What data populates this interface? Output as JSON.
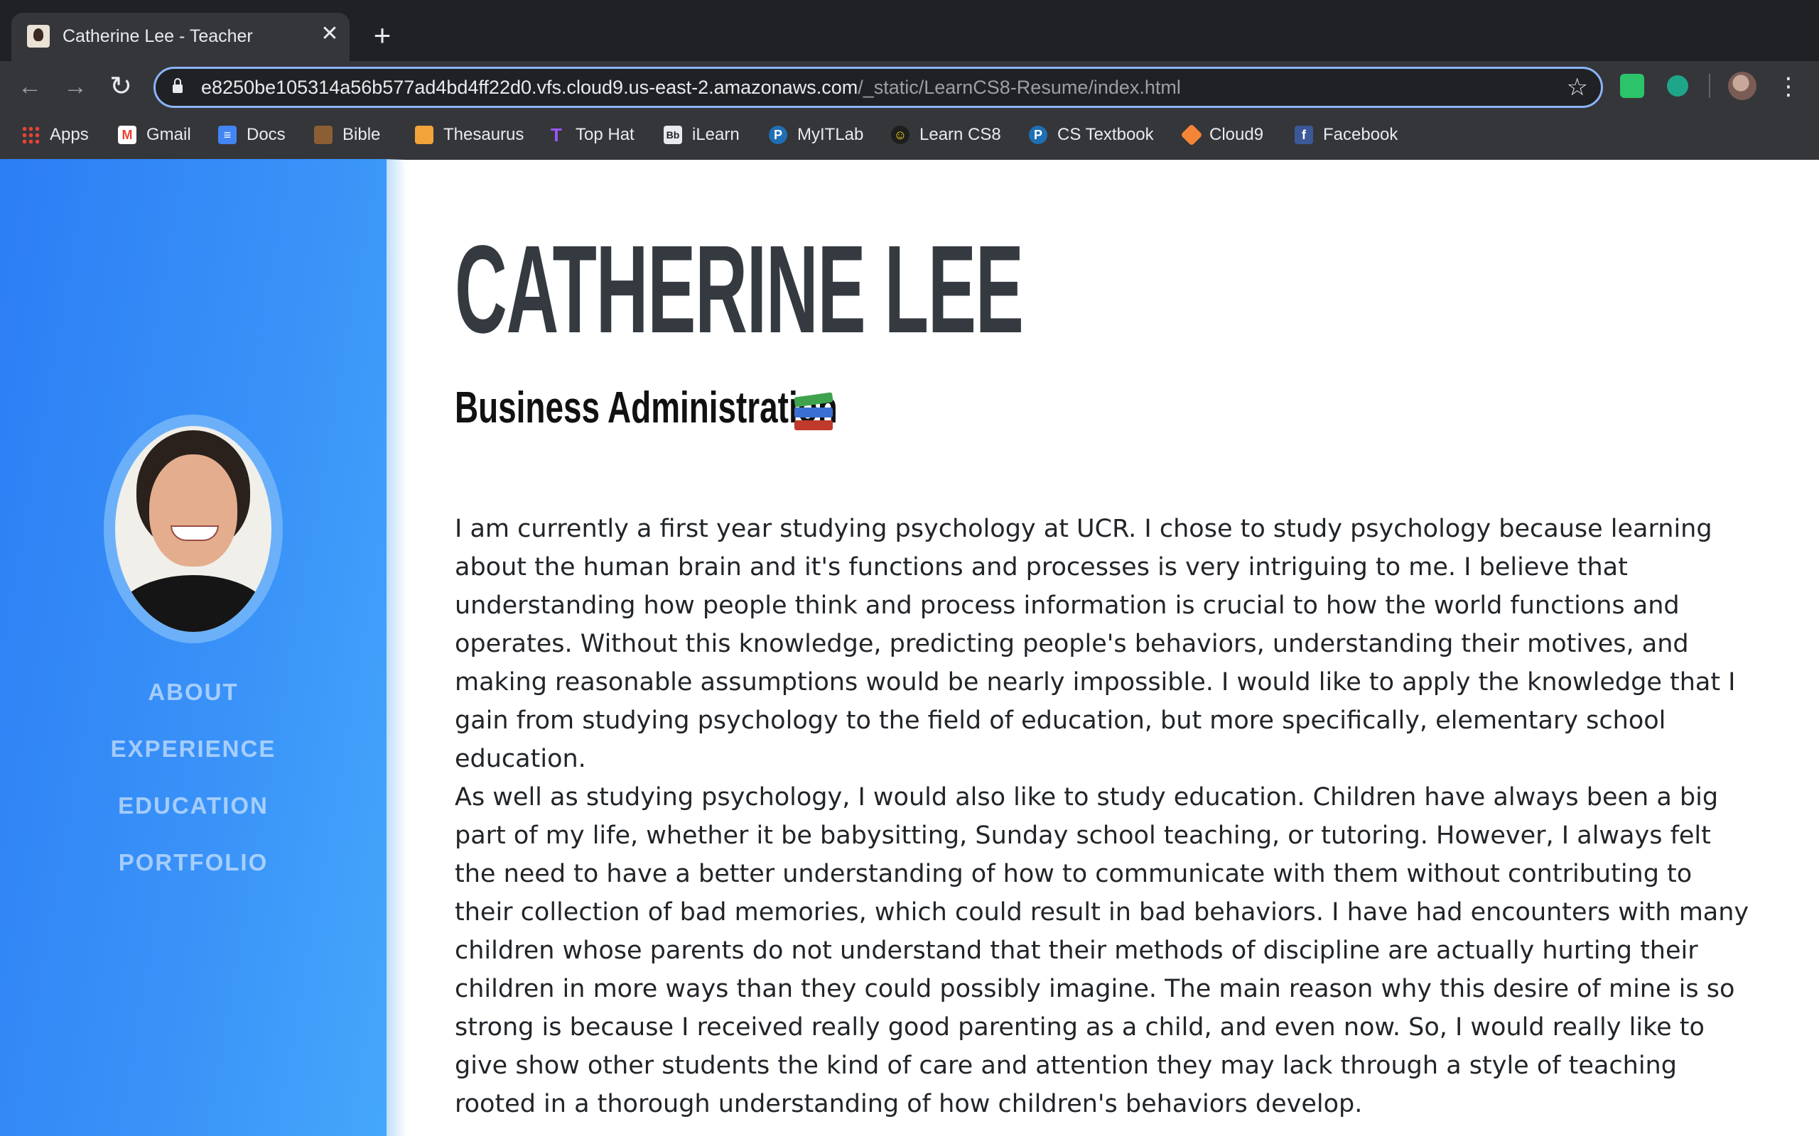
{
  "browser": {
    "tab_title": "Catherine Lee - Teacher",
    "url_host": "e8250be105314a56b577ad4bd4ff22d0.vfs.cloud9.us-east-2.amazonaws.com",
    "url_path": "/_static/LearnCS8-Resume/index.html",
    "bookmarks": [
      {
        "label": "Apps",
        "icon": "apps-grid-icon"
      },
      {
        "label": "Gmail",
        "icon": "gmail-icon"
      },
      {
        "label": "Docs",
        "icon": "docs-icon"
      },
      {
        "label": "Bible",
        "icon": "bible-icon"
      },
      {
        "label": "Thesaurus",
        "icon": "thesaurus-icon"
      },
      {
        "label": "Top Hat",
        "icon": "tophat-icon"
      },
      {
        "label": "iLearn",
        "icon": "blackboard-icon"
      },
      {
        "label": "MyITLab",
        "icon": "pearson-icon"
      },
      {
        "label": "Learn CS8",
        "icon": "learncs8-icon"
      },
      {
        "label": "CS Textbook",
        "icon": "pearson-icon"
      },
      {
        "label": "Cloud9",
        "icon": "cloud9-icon"
      },
      {
        "label": "Facebook",
        "icon": "facebook-icon"
      }
    ],
    "icons": {
      "back": "←",
      "forward": "→",
      "reload": "↻",
      "star": "☆",
      "close": "✕",
      "new_tab": "+",
      "menu": "⋮"
    }
  },
  "colors": {
    "sidebar_start": "#2c7ef4",
    "sidebar_end": "#45a7fb",
    "name_color": "#343a40",
    "text_color": "#212529"
  },
  "sidebar": {
    "nav": [
      "ABOUT",
      "EXPERIENCE",
      "EDUCATION",
      "PORTFOLIO"
    ]
  },
  "main": {
    "name": "CATHERINE LEE",
    "subtitle": "Business Administration",
    "paragraphs": [
      "I am currently a first year studying psychology at UCR. I chose to study psychology because learning about the human brain and it's functions and processes is very intriguing to me. I believe that understanding how people think and process information is crucial to how the world functions and operates. Without this knowledge, predicting people's behaviors, understanding their motives, and making reasonable assumptions would be nearly impossible. I would like to apply the knowledge that I gain from studying psychology to the field of education, but more specifically, elementary school education.",
      "As well as studying psychology, I would also like to study education. Children have always been a big part of my life, whether it be babysitting, Sunday school teaching, or tutoring. However, I always felt the need to have a better understanding of how to communicate with them without contributing to their collection of bad memories, which could result in bad behaviors. I have had encounters with many children whose parents do not understand that their methods of discipline are actually hurting their children in more ways than they could possibly imagine. The main reason why this desire of mine is so strong is because I received really good parenting as a child, and even now. So, I would really like to give show other students the kind of care and attention they may lack through a style of teaching rooted in a thorough understanding of how children's behaviors develop."
    ]
  }
}
